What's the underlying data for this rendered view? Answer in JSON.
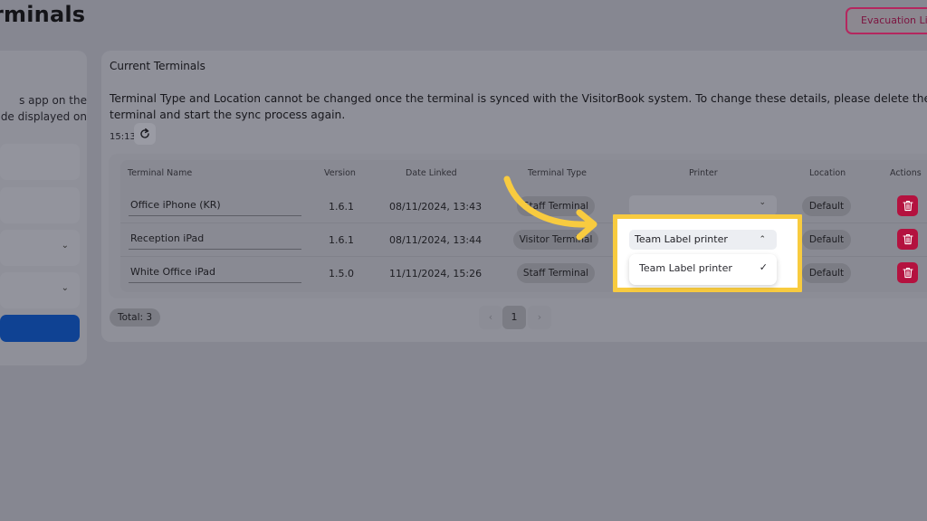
{
  "page": {
    "title": "rminals"
  },
  "header": {
    "evacuation_button": "Evacuation List"
  },
  "left_panel": {
    "text_lines": [
      "s app on the",
      "de displayed on"
    ],
    "select_chevron": "⌄"
  },
  "main": {
    "title": "Current Terminals",
    "notice": "Terminal Type and Location cannot be changed once the terminal is synced with the VisitorBook system. To change these details, please delete the terminal and start the sync process again.",
    "sync_time": "15:13",
    "refresh_icon": "refresh-icon"
  },
  "table": {
    "headers": {
      "name": "Terminal Name",
      "version": "Version",
      "date_linked": "Date Linked",
      "terminal_type": "Terminal Type",
      "printer": "Printer",
      "location": "Location",
      "actions": "Actions"
    },
    "rows": [
      {
        "name": "Office iPhone (KR)",
        "version": "1.6.1",
        "date_linked": "08/11/2024, 13:43",
        "terminal_type": "Staff Terminal",
        "printer": "",
        "location": "Default"
      },
      {
        "name": "Reception iPad",
        "version": "1.6.1",
        "date_linked": "08/11/2024, 13:44",
        "terminal_type": "Visitor Terminal",
        "printer": "Team Label printer",
        "location": "Default"
      },
      {
        "name": "White Office iPad",
        "version": "1.5.0",
        "date_linked": "11/11/2024, 15:26",
        "terminal_type": "Staff Terminal",
        "printer": "",
        "location": "Default"
      }
    ]
  },
  "printer_dropdown": {
    "selected": "Team Label printer",
    "options": [
      {
        "label": "Team Label printer",
        "checked": true
      }
    ],
    "check_glyph": "✓",
    "chevron_up": "⌃",
    "chevron_down": "⌄"
  },
  "footer": {
    "total": "Total: 3",
    "prev": "‹",
    "current_page": "1",
    "next": "›"
  },
  "colors": {
    "highlight": "#f8cb3f",
    "delete": "#b4123f",
    "primary": "#0f4293",
    "evacuation": "#b4275f"
  }
}
